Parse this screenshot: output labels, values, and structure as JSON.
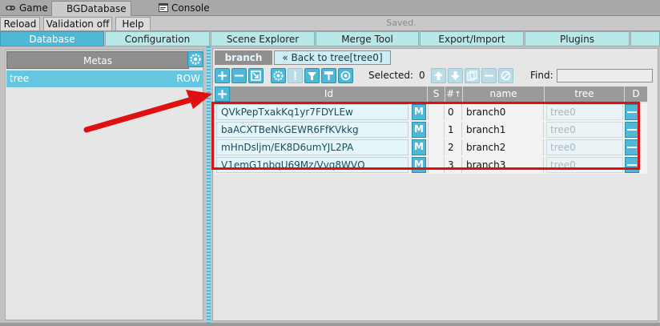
{
  "window_tabs": [
    {
      "label": "Game",
      "icon": "gamepad-icon"
    },
    {
      "label": "BGDatabase",
      "icon": ""
    },
    {
      "label": "Console",
      "icon": "console-icon"
    }
  ],
  "toolbar": {
    "reload_label": "Reload",
    "validation_label": "Validation off",
    "help_label": "Help",
    "status_text": "Saved."
  },
  "main_tabs": [
    {
      "label": "Database",
      "active": true
    },
    {
      "label": "Configuration",
      "active": false
    },
    {
      "label": "Scene Explorer",
      "active": false
    },
    {
      "label": "Merge Tool",
      "active": false
    },
    {
      "label": "Export/Import",
      "active": false
    },
    {
      "label": "Plugins",
      "active": false
    }
  ],
  "metas_panel": {
    "header": "Metas",
    "items": [
      {
        "name": "tree",
        "tag": "ROW"
      }
    ]
  },
  "meta_view": {
    "tab_label": "branch",
    "back_label": "Back to tree[tree0]",
    "selected_label": "Selected:",
    "selected_count": "0",
    "find_label": "Find:",
    "find_value": ""
  },
  "table": {
    "columns": [
      "Id",
      "S",
      "#",
      "name",
      "tree",
      "D"
    ],
    "rows": [
      {
        "id": "QVkPepTxakKq1yr7FDYLEw",
        "m": "M",
        "num": "0",
        "name": "branch0",
        "tree": "tree0"
      },
      {
        "id": "baACXTBeNkGEWR6FfKVkkg",
        "m": "M",
        "num": "1",
        "name": "branch1",
        "tree": "tree0"
      },
      {
        "id": "mHnDsljm/EK8D6umYJL2PA",
        "m": "M",
        "num": "2",
        "name": "branch2",
        "tree": "tree0"
      },
      {
        "id": "V1emG1nbqU69Mz/Vvq8WVQ",
        "m": "M",
        "num": "3",
        "name": "branch3",
        "tree": "tree0"
      }
    ]
  },
  "colors": {
    "accent": "#4fb8d6",
    "highlight_box": "#e01010",
    "arrow": "#e01010"
  }
}
